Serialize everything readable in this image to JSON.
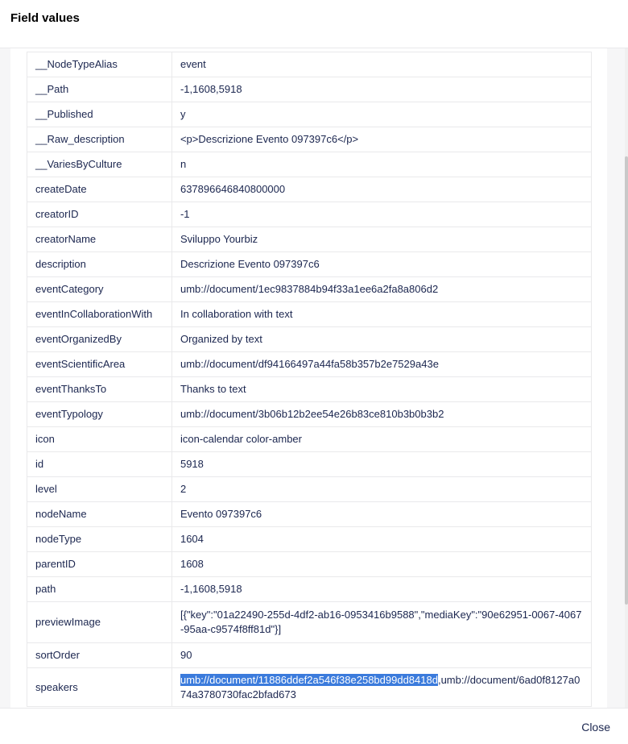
{
  "dialog": {
    "title": "Field values",
    "close_label": "Close"
  },
  "fields": [
    {
      "key": "__NodeTypeAlias",
      "value": "event"
    },
    {
      "key": "__Path",
      "value": "-1,1608,5918"
    },
    {
      "key": "__Published",
      "value": "y"
    },
    {
      "key": "__Raw_description",
      "value": "<p>Descrizione Evento 097397c6</p>"
    },
    {
      "key": "__VariesByCulture",
      "value": "n"
    },
    {
      "key": "createDate",
      "value": "637896646840800000"
    },
    {
      "key": "creatorID",
      "value": "-1"
    },
    {
      "key": "creatorName",
      "value": "Sviluppo Yourbiz"
    },
    {
      "key": "description",
      "value": "Descrizione Evento 097397c6"
    },
    {
      "key": "eventCategory",
      "value": "umb://document/1ec9837884b94f33a1ee6a2fa8a806d2"
    },
    {
      "key": "eventInCollaborationWith",
      "value": "In collaboration with text"
    },
    {
      "key": "eventOrganizedBy",
      "value": "Organized by text"
    },
    {
      "key": "eventScientificArea",
      "value": "umb://document/df94166497a44fa58b357b2e7529a43e"
    },
    {
      "key": "eventThanksTo",
      "value": "Thanks to text"
    },
    {
      "key": "eventTypology",
      "value": "umb://document/3b06b12b2ee54e26b83ce810b3b0b3b2"
    },
    {
      "key": "icon",
      "value": "icon-calendar color-amber"
    },
    {
      "key": "id",
      "value": "5918"
    },
    {
      "key": "level",
      "value": "2"
    },
    {
      "key": "nodeName",
      "value": "Evento 097397c6"
    },
    {
      "key": "nodeType",
      "value": "1604"
    },
    {
      "key": "parentID",
      "value": "1608"
    },
    {
      "key": "path",
      "value": "-1,1608,5918"
    },
    {
      "key": "previewImage",
      "value": "[{\"key\":\"01a22490-255d-4df2-ab16-0953416b9588\",\"mediaKey\":\"90e62951-0067-4067-95aa-c9574f8ff81d\"}]"
    },
    {
      "key": "sortOrder",
      "value": "90"
    }
  ],
  "speakers": {
    "key": "speakers",
    "value_selected": "umb://document/11886ddef2a546f38e258bd99dd8418d",
    "value_rest": ",umb://document/6ad0f8127a074a3780730fac2bfad673"
  }
}
